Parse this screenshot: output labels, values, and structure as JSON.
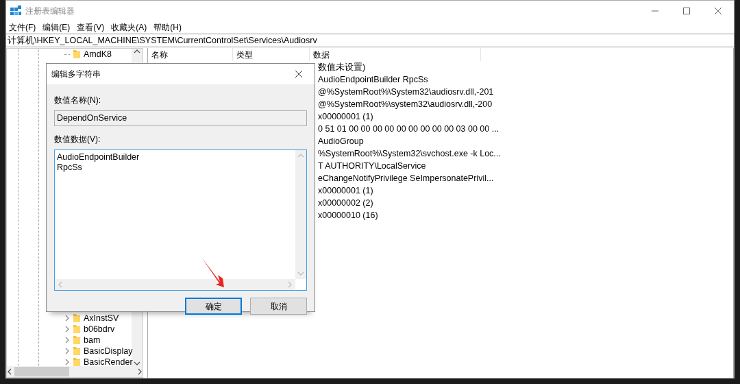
{
  "window": {
    "title": "注册表编辑器"
  },
  "menu": [
    "文件(F)",
    "编辑(E)",
    "查看(V)",
    "收藏夹(A)",
    "帮助(H)"
  ],
  "address": "计算机\\HKEY_LOCAL_MACHINE\\SYSTEM\\CurrentControlSet\\Services\\Audiosrv",
  "tree": [
    {
      "label": "AmdK8",
      "expandable": false
    },
    {
      "label": "AxInstSV",
      "expandable": true
    },
    {
      "label": "b06bdrv",
      "expandable": true
    },
    {
      "label": "bam",
      "expandable": true
    },
    {
      "label": "BasicDisplay",
      "expandable": true
    },
    {
      "label": "BasicRender",
      "expandable": true
    }
  ],
  "table": {
    "columns": [
      "名称",
      "类型",
      "数据"
    ],
    "rows": [
      "数值未设置)",
      "AudioEndpointBuilder RpcSs",
      "@%SystemRoot%\\System32\\audiosrv.dll,-201",
      "@%SystemRoot%\\system32\\audiosrv.dll,-200",
      "x00000001 (1)",
      "0 51 01 00 00 00 00 00 00 00 00 00 03 00 00 ...",
      "AudioGroup",
      "%SystemRoot%\\System32\\svchost.exe -k Loc...",
      "T AUTHORITY\\LocalService",
      "eChangeNotifyPrivilege SeImpersonatePrivil...",
      "x00000001 (1)",
      "x00000002 (2)",
      "x00000010 (16)"
    ]
  },
  "dialog": {
    "title": "编辑多字符串",
    "name_label": "数值名称(N):",
    "name_value": "DependOnService",
    "data_label": "数值数据(V):",
    "data_lines": [
      "AudioEndpointBuilder",
      "RpcSs"
    ],
    "buttons": [
      {
        "label": "确定",
        "focused": true
      },
      {
        "label": "取消",
        "focused": false
      }
    ]
  }
}
